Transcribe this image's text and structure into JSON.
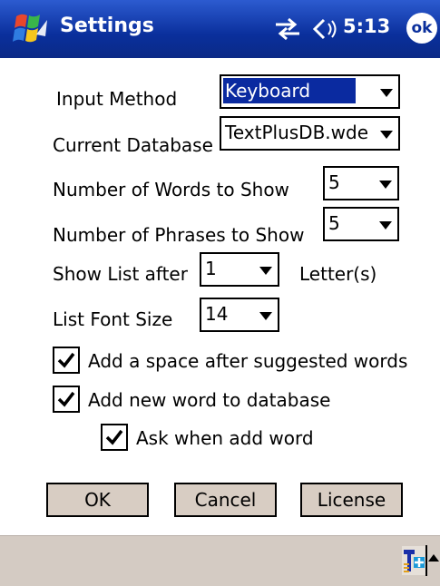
{
  "titlebar": {
    "title": "Settings",
    "time": "5:13",
    "ok": "ok"
  },
  "form": {
    "input_method": {
      "label": "Input Method",
      "value": "Keyboard"
    },
    "current_database": {
      "label": "Current Database",
      "value": "TextPlusDB.wde"
    },
    "words_to_show": {
      "label": "Number of Words to Show",
      "value": "5"
    },
    "phrases_to_show": {
      "label": "Number of Phrases to Show",
      "value": "5"
    },
    "show_list_after": {
      "label": "Show List after",
      "value": "1",
      "suffix": "Letter(s)"
    },
    "list_font_size": {
      "label": "List Font Size",
      "value": "14"
    }
  },
  "checkboxes": {
    "add_space": {
      "label": "Add a space after suggested words",
      "checked": true
    },
    "add_new_word": {
      "label": "Add new word to database",
      "checked": true
    },
    "ask_when_add": {
      "label": "Ask when add word",
      "checked": true
    }
  },
  "buttons": {
    "ok": "OK",
    "cancel": "Cancel",
    "license": "License"
  },
  "icons": {
    "start": "windows-start-icon",
    "connectivity": "connectivity-icon",
    "volume": "volume-icon",
    "sip": "input-panel-icon"
  },
  "colors": {
    "titlebar": "#0a2f9c",
    "selection": "#0a2aa0",
    "button_face": "#d8cdc3",
    "bottom_bar": "#d4cbc3"
  }
}
